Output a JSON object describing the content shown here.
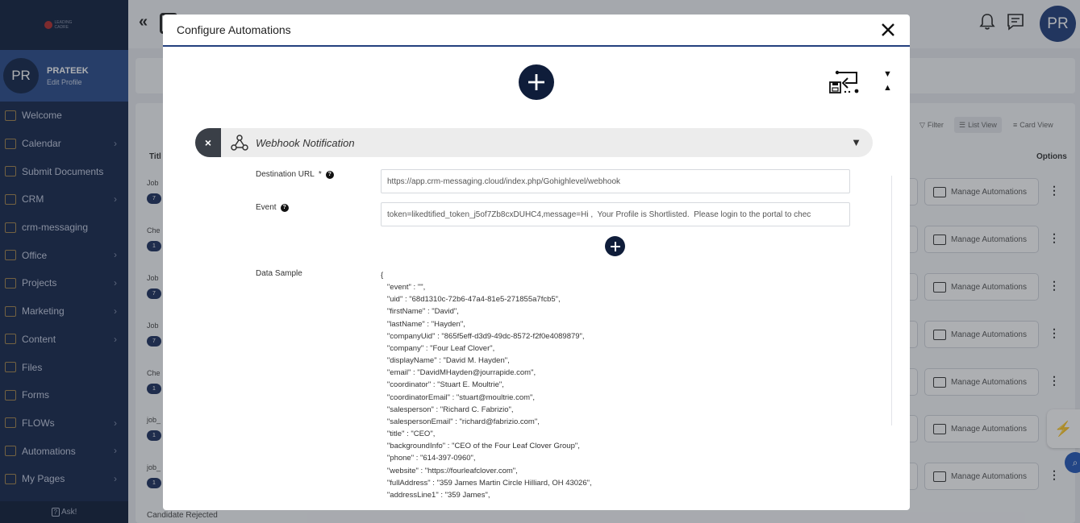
{
  "sidebar": {
    "profile": {
      "initials": "PR",
      "name": "PRATEEK",
      "edit": "Edit Profile"
    },
    "items": [
      {
        "label": "Welcome",
        "chevron": false
      },
      {
        "label": "Calendar",
        "chevron": true
      },
      {
        "label": "Submit Documents",
        "chevron": false
      },
      {
        "label": "CRM",
        "chevron": true
      },
      {
        "label": "crm-messaging",
        "chevron": false
      },
      {
        "label": "Office",
        "chevron": true
      },
      {
        "label": "Projects",
        "chevron": true
      },
      {
        "label": "Marketing",
        "chevron": true
      },
      {
        "label": "Content",
        "chevron": true
      },
      {
        "label": "Files",
        "chevron": false
      },
      {
        "label": "Forms",
        "chevron": false
      },
      {
        "label": "FLOWs",
        "chevron": true
      },
      {
        "label": "Automations",
        "chevron": true
      },
      {
        "label": "My Pages",
        "chevron": true
      }
    ],
    "ask": "Ask!"
  },
  "header": {
    "avatar_initials": "PR"
  },
  "background": {
    "filter": "Filter",
    "list_view": "List View",
    "card_view": "Card View",
    "options_header": "Options",
    "title_header": "Titl",
    "rows": [
      {
        "label": "Job",
        "pill": "7"
      },
      {
        "label": "Che",
        "pill": "1"
      },
      {
        "label": "Job",
        "pill": "7"
      },
      {
        "label": "Job",
        "pill": "7"
      },
      {
        "label": "Che",
        "pill": "1"
      },
      {
        "label": "job_",
        "pill": "1"
      },
      {
        "label": "job_",
        "pill": "1"
      }
    ],
    "manage_label": "Manage Automations",
    "candidate_rejected": "Candidate Rejected"
  },
  "modal": {
    "title": "Configure Automations",
    "webhook_label": "Webhook Notification",
    "destination_label": "Destination URL",
    "destination_required": "*",
    "destination_value": "https://app.crm-messaging.cloud/index.php/Gohighlevel/webhook",
    "event_label": "Event",
    "event_value": "token=likedtified_token_j5of7Zb8cxDUHC4,message=Hi ,  Your Profile is Shortlisted.  Please login to the portal to chec",
    "data_sample_label": "Data Sample",
    "data_sample": [
      "{",
      "   \"event\" : \"\",",
      "   \"uid\" : \"68d1310c-72b6-47a4-81e5-271855a7fcb5\",",
      "   \"firstName\" : \"David\",",
      "   \"lastName\" : \"Hayden\",",
      "   \"companyUid\" : \"865f5eff-d3d9-49dc-8572-f2f0e4089879\",",
      "   \"company\" : \"Four Leaf Clover\",",
      "   \"displayName\" : \"David M. Hayden\",",
      "   \"email\" : \"DavidMHayden@jourrapide.com\",",
      "   \"coordinator\" : \"Stuart E. Moultrie\",",
      "   \"coordinatorEmail\" : \"stuart@moultrie.com\",",
      "   \"salesperson\" : \"Richard C. Fabrizio\",",
      "   \"salespersonEmail\" : \"richard@fabrizio.com\",",
      "   \"title\" : \"CEO\",",
      "   \"backgroundInfo\" : \"CEO of the Four Leaf Clover Group\",",
      "   \"phone\" : \"614-397-0960\",",
      "   \"website\" : \"https://fourleafclover.com\",",
      "   \"fullAddress\" : \"359 James Martin Circle Hilliard, OH 43026\",",
      "   \"addressLine1\" : \"359 James\","
    ]
  },
  "colors": {
    "sidebar": "#13254a",
    "accent": "#23407e",
    "dark_button": "#0f1d3a"
  }
}
